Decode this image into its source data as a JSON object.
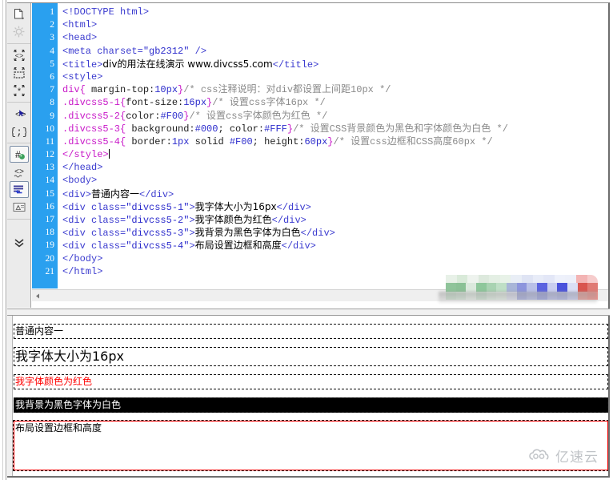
{
  "window": {
    "title": "Dreamweaver Code and Design View"
  },
  "toolbar": {
    "name": "coding-toolbar",
    "buttons": [
      {
        "icon": "open-documents-icon",
        "label": "Open Documents",
        "state": "normal"
      },
      {
        "icon": "snippets-icon",
        "label": "Snippets",
        "state": "disabled"
      },
      {
        "icon": "collapse-full-tag-icon",
        "label": "Collapse Full Tag",
        "state": "normal"
      },
      {
        "icon": "collapse-selection-icon",
        "label": "Collapse Selection",
        "state": "normal"
      },
      {
        "icon": "expand-all-icon",
        "label": "Expand All",
        "state": "normal"
      },
      {
        "icon": "select-parent-tag-icon",
        "label": "Select Parent Tag",
        "state": "normal"
      },
      {
        "icon": "balance-braces-icon",
        "label": "Balance Braces",
        "state": "normal"
      },
      {
        "icon": "line-numbers-icon",
        "label": "Line Numbers",
        "state": "active"
      },
      {
        "icon": "highlight-invalid-code-icon",
        "label": "Highlight Invalid Code",
        "state": "normal"
      },
      {
        "icon": "word-wrap-icon",
        "label": "Word Wrap",
        "state": "active"
      },
      {
        "icon": "syntax-error-alerts-icon",
        "label": "Syntax Error Alerts in Info Bar",
        "state": "normal"
      },
      {
        "icon": "chevron-double-down-icon",
        "label": "More Options",
        "state": "normal"
      }
    ]
  },
  "editor": {
    "line_numbers": [
      "1",
      "2",
      "3",
      "4",
      "5",
      "6",
      "7",
      "8",
      "9",
      "10",
      "11",
      "12",
      "13",
      "14",
      "15",
      "16",
      "17",
      "18",
      "19",
      "20",
      "21"
    ],
    "gutter_color": "#2aa0ef",
    "lines": [
      {
        "n": 1,
        "text": "<!DOCTYPE html>"
      },
      {
        "n": 2,
        "text": "<html>"
      },
      {
        "n": 3,
        "text": "<head>"
      },
      {
        "n": 4,
        "text": "<meta charset=\"gb2312\" />"
      },
      {
        "n": 5,
        "text": "<title>div的用法在线演示 www.divcss5.com</title>"
      },
      {
        "n": 6,
        "text": "<style>"
      },
      {
        "n": 7,
        "text": "div{ margin-top:10px}/* css注释说明：对div都设置上间距10px */"
      },
      {
        "n": 8,
        "text": ".divcss5-1{font-size:16px}/* 设置css字体16px */"
      },
      {
        "n": 9,
        "text": ".divcss5-2{color:#F00}/* 设置css字体颜色为红色 */"
      },
      {
        "n": 10,
        "text": ".divcss5-3{ background:#000; color:#FFF}/* 设置CSS背景颜色为黑色和字体颜色为白色 */"
      },
      {
        "n": 11,
        "text": ".divcss5-4{ border:1px solid #F00; height:60px}/* 设置css边框和CSS高度60px */"
      },
      {
        "n": 12,
        "text": "</style>"
      },
      {
        "n": 13,
        "text": "</head>"
      },
      {
        "n": 14,
        "text": "<body>"
      },
      {
        "n": 15,
        "text": "<div>普通内容一</div>"
      },
      {
        "n": 16,
        "text": "<div class=\"divcss5-1\">我字体大小为16px</div>"
      },
      {
        "n": 17,
        "text": "<div class=\"divcss5-2\">我字体颜色为红色</div>"
      },
      {
        "n": 18,
        "text": "<div class=\"divcss5-3\">我背景为黑色字体为白色</div>"
      },
      {
        "n": 19,
        "text": "<div class=\"divcss5-4\">布局设置边框和高度</div>"
      },
      {
        "n": 20,
        "text": "</body>"
      },
      {
        "n": 21,
        "text": "</html>"
      }
    ],
    "syntax_colors": {
      "tag": "#3b3bcf",
      "selector": "#c818c8",
      "value": "#2c2ccc",
      "comment": "#8a8a8a",
      "plain": "#000000"
    },
    "caret_line": 12
  },
  "preview": {
    "blocks": [
      {
        "text": "普通内容一",
        "style": "default"
      },
      {
        "text": "我字体大小为16px",
        "style": "font-16px"
      },
      {
        "text": "我字体颜色为红色",
        "style": "color-red"
      },
      {
        "text": "我背景为黑色字体为白色",
        "style": "bg-black-text-white"
      },
      {
        "text": "布局设置边框和高度",
        "style": "border-red-height-60px"
      }
    ]
  },
  "mosaic": {
    "label": "pixelated-censored-region",
    "rows": [
      [
        "#e8f1e8",
        "#d9ead9",
        "#eef3ee",
        "#dde9dd",
        "#e4efe4",
        "#e8f2e8",
        "#e9eef6",
        "#dfe4f4",
        "#e8ecf8",
        "#e3e7f7",
        "#eef1fb",
        "#edf0fa",
        "#f3b4b4",
        "#f6cccc"
      ],
      [
        "#8fc49a",
        "#8bc196",
        "#dbe9dd",
        "#8ec79b",
        "#a9d3b2",
        "#bfdfc6",
        "#a8b5d8",
        "#8d95dd",
        "#b9c0e8",
        "#5b63e0",
        "#c9cef0",
        "#4a52dc",
        "#dadef5",
        "#d9554f",
        "#e07a74"
      ],
      [
        "#cfe3d2",
        "#d7e8da",
        "#e9f2ea",
        "#cfe5d4",
        "#dfeee2",
        "#e6f1e8",
        "#dfe2f2",
        "#a6acdf",
        "#b5bbe6",
        "#9aa1e0",
        "#b8bde9",
        "#aeb4e5",
        "#c9cdf0",
        "#e79a96",
        "#ef8d88"
      ]
    ]
  },
  "scrollbar": {
    "left_arrow_icon": "triangle-left-icon"
  },
  "watermark": {
    "icon": "cloud-logo-icon",
    "text": "亿速云",
    "color": "#9aa0a6"
  }
}
